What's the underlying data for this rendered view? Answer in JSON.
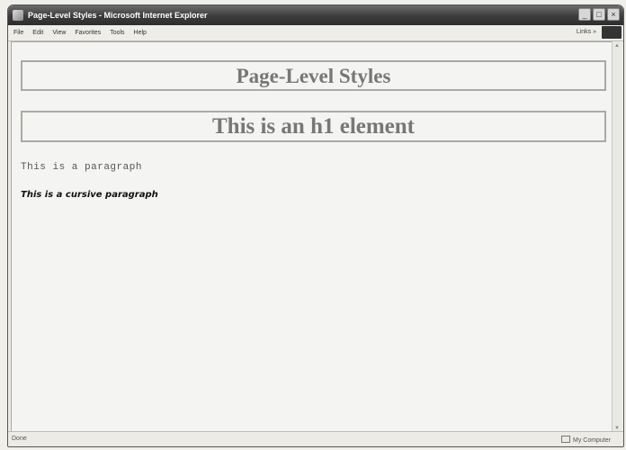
{
  "window": {
    "title": "Page-Level Styles - Microsoft Internet Explorer",
    "controls": [
      "_",
      "□",
      "×"
    ]
  },
  "menu": {
    "items": [
      "File",
      "Edit",
      "View",
      "Favorites",
      "Tools",
      "Help"
    ],
    "links_label": "Links »"
  },
  "page": {
    "title_heading": "Page-Level Styles",
    "h1_heading": "This is an h1 element",
    "paragraph": "This is a paragraph",
    "cursive_paragraph": "This is a cursive paragraph"
  },
  "status": {
    "left": "Done",
    "right": "My Computer"
  }
}
